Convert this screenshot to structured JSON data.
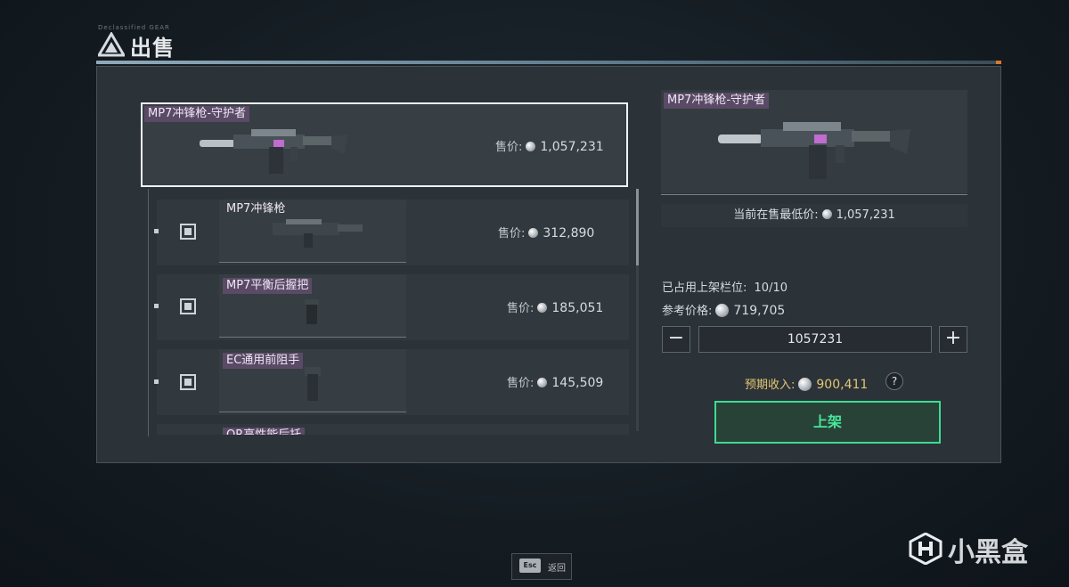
{
  "header": {
    "title": "出售",
    "subtitle": "Declassified  GEAR"
  },
  "selected_item": {
    "name": "MP7冲锋枪-守护者",
    "price_label": "售价:",
    "price": "1,057,231"
  },
  "items": [
    {
      "name": "MP7冲锋枪",
      "price_label": "售价:",
      "price": "312,890"
    },
    {
      "name": "MP7平衡后握把",
      "price_label": "售价:",
      "price": "185,051"
    },
    {
      "name": "EC通用前阻手",
      "price_label": "售价:",
      "price": "145,509"
    },
    {
      "name": "QR高性能后托"
    }
  ],
  "detail": {
    "name": "MP7冲锋枪-守护者",
    "lowest_label": "当前在售最低价:",
    "lowest_price": "1,057,231",
    "slots_label": "已占用上架栏位:",
    "slots_value": "10/10",
    "ref_label": "参考价格:",
    "ref_price": "719,705",
    "minus": "−",
    "plus": "+",
    "input_value": "1057231",
    "income_label": "预期收入:",
    "income_value": "900,411",
    "help": "?",
    "list_button": "上架"
  },
  "footer": {
    "esc_key": "Esc",
    "esc_label": "返回"
  },
  "watermark": "小黑盒",
  "colors": {
    "accent_green": "#3ddc94",
    "tag_purple": "#5a4a66",
    "income_gold": "#e3c674",
    "header_orange": "#d87a30"
  }
}
